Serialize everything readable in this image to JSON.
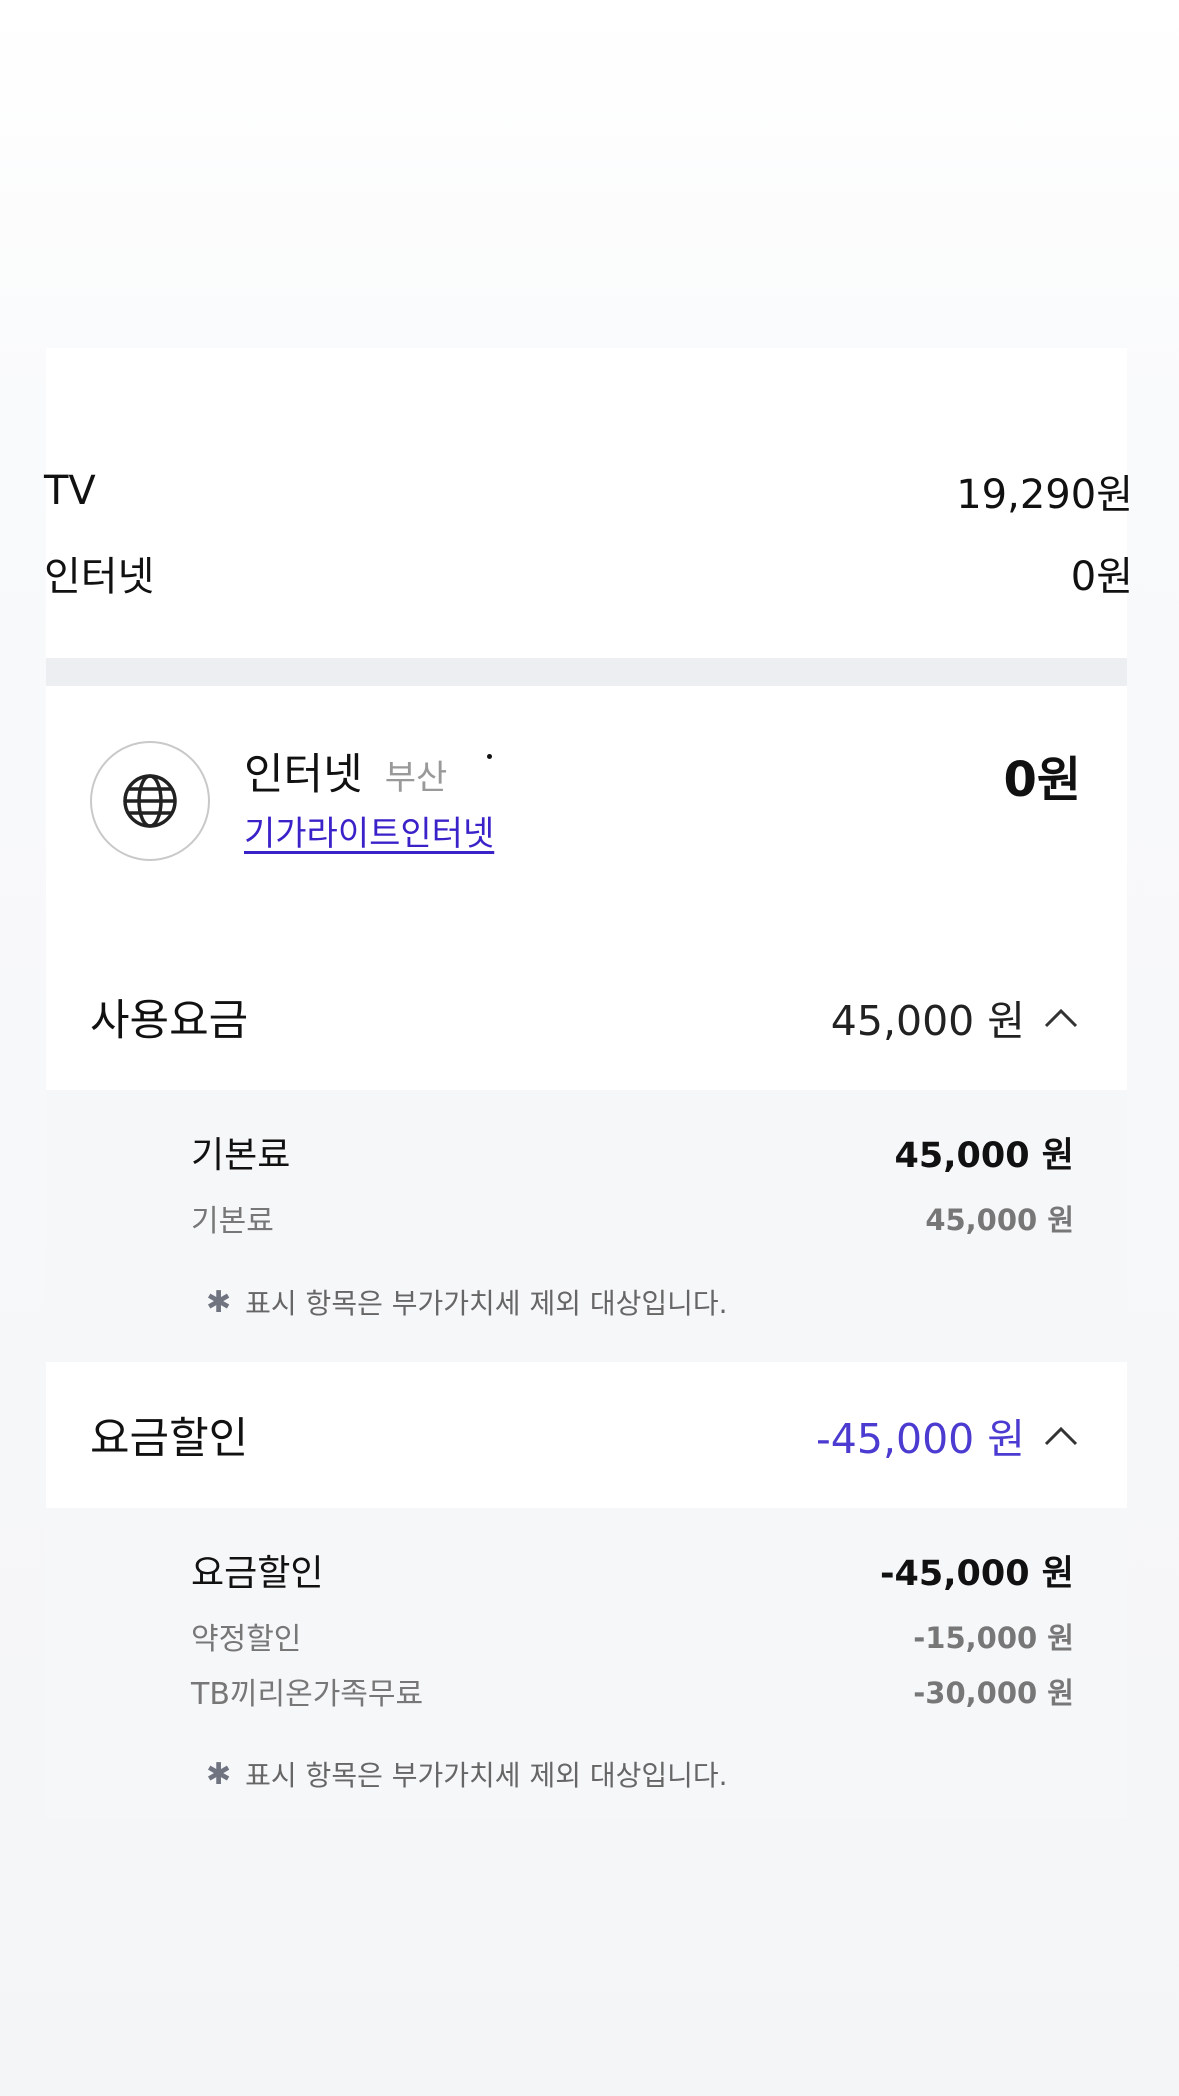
{
  "summary": {
    "rows": [
      {
        "label": "TV",
        "amount": "19,290원"
      },
      {
        "label": "인터넷",
        "amount": "0원"
      }
    ]
  },
  "service": {
    "icon": "globe-icon",
    "title": "인터넷",
    "region": "부산",
    "plan": "기가라이트인터넷",
    "amount": "0원"
  },
  "usage": {
    "label": "사용요금",
    "amount": "45,000 원",
    "detail_title": "기본료",
    "detail_title_amount": "45,000 원",
    "items": [
      {
        "label": "기본료",
        "amount": "45,000 원"
      }
    ],
    "note": "표시 항목은 부가가치세 제외 대상입니다."
  },
  "discount": {
    "label": "요금할인",
    "amount": "-45,000 원",
    "detail_title": "요금할인",
    "detail_title_amount": "-45,000 원",
    "items": [
      {
        "label": "약정할인",
        "amount": "-15,000 원"
      },
      {
        "label": "TB끼리온가족무료",
        "amount": "-30,000 원"
      }
    ],
    "note": "표시 항목은 부가가치세 제외 대상입니다."
  },
  "colors": {
    "accent": "#4b3bd0",
    "link": "#3a22c9"
  }
}
